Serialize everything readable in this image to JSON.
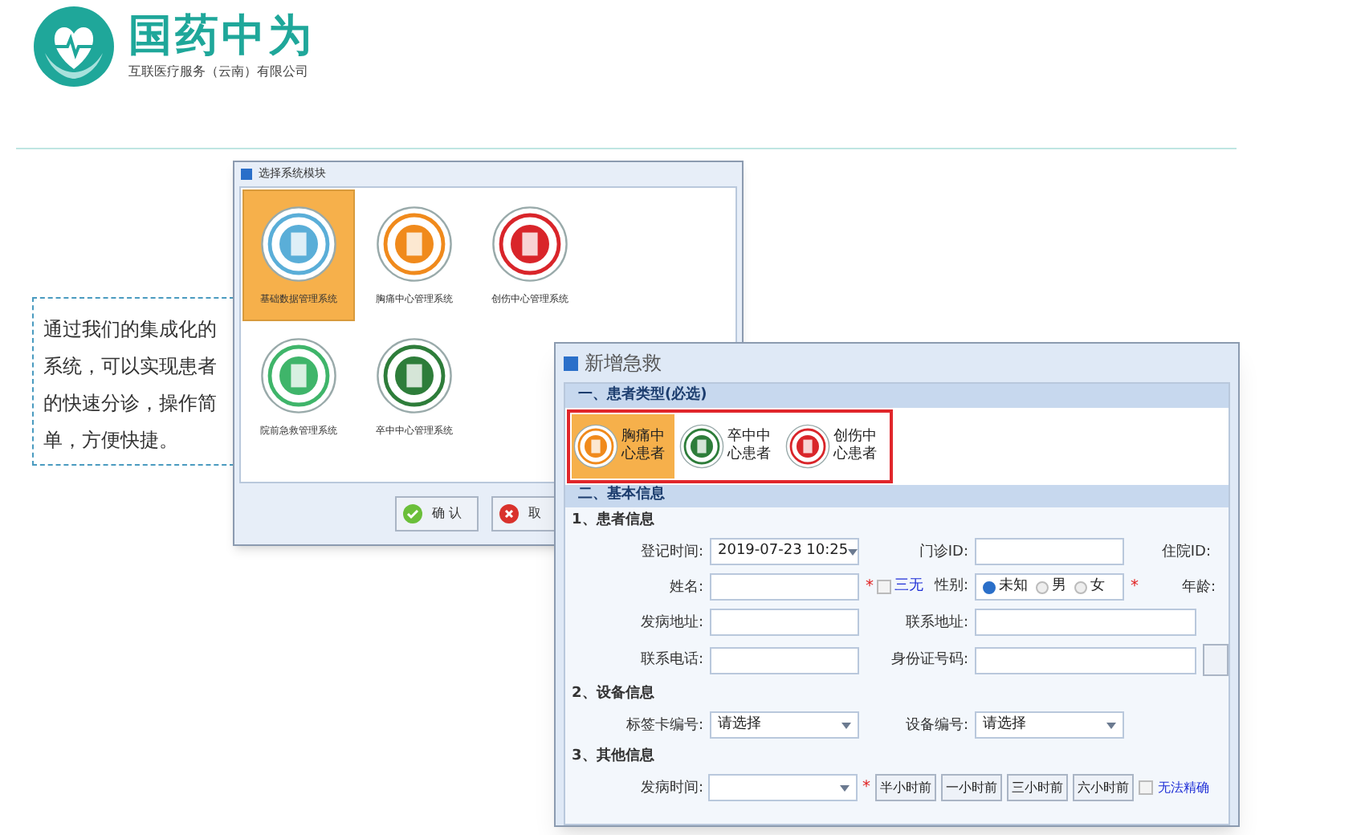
{
  "logo": {
    "title": "国药中为",
    "subtitle": "互联医疗服务（云南）有限公司"
  },
  "caption": "通过我们的集成化的系统，可以实现患者的快速分诊，操作简单，方便快捷。",
  "module_dialog": {
    "title": "选择系统模块",
    "modules": [
      {
        "label": "基础数据管理系统",
        "selected": true,
        "color": "#5aaed8"
      },
      {
        "label": "胸痛中心管理系统",
        "selected": false,
        "color": "#f08a1c"
      },
      {
        "label": "创伤中心管理系统",
        "selected": false,
        "color": "#d9252a"
      },
      {
        "label": "院前急救管理系统",
        "selected": false,
        "color": "#3fb56a"
      },
      {
        "label": "卒中中心管理系统",
        "selected": false,
        "color": "#2e7d3a"
      }
    ],
    "buttons": [
      {
        "label": "确 认",
        "kind": "ok"
      },
      {
        "label": "取",
        "kind": "cancel"
      }
    ]
  },
  "rescue_dialog": {
    "title": "新增急救",
    "type_section": "一、患者类型(必选)",
    "patient_types": [
      {
        "label": "胸痛中心患者",
        "selected": true,
        "color": "#f08a1c"
      },
      {
        "label": "卒中中心患者",
        "selected": false,
        "color": "#2e7d3a"
      },
      {
        "label": "创伤中心患者",
        "selected": false,
        "color": "#d9252a"
      }
    ],
    "basic_section": "二、基本信息",
    "required_mark": "*",
    "patient_info": {
      "heading": "1、患者信息",
      "registered_time": {
        "label": "登记时间:",
        "value": "2019-07-23 10:25"
      },
      "outpatient_id": {
        "label": "门诊ID:"
      },
      "inpatient_id": {
        "label": "住院ID:"
      },
      "name": {
        "label": "姓名:"
      },
      "no_identity": {
        "label": "三无",
        "checked": false
      },
      "gender": {
        "label": "性别:",
        "options": [
          {
            "label": "未知",
            "selected": true
          },
          {
            "label": "男",
            "selected": false
          },
          {
            "label": "女",
            "selected": false
          }
        ]
      },
      "age": {
        "label": "年龄:"
      },
      "onset_address": {
        "label": "发病地址:"
      },
      "contact_address": {
        "label": "联系地址:"
      },
      "phone": {
        "label": "联系电话:"
      },
      "id_number": {
        "label": "身份证号码:"
      }
    },
    "device_info": {
      "heading": "2、设备信息",
      "tag_card": {
        "label": "标签卡编号:",
        "value": "请选择"
      },
      "device_no": {
        "label": "设备编号:",
        "value": "请选择"
      }
    },
    "other_info": {
      "heading": "3、其他信息",
      "onset_time": {
        "label": "发病时间:"
      },
      "quick_times": [
        "半小时前",
        "一小时前",
        "三小时前",
        "六小时前"
      ],
      "imprecise": {
        "label": "无法精确",
        "checked": false
      }
    }
  }
}
